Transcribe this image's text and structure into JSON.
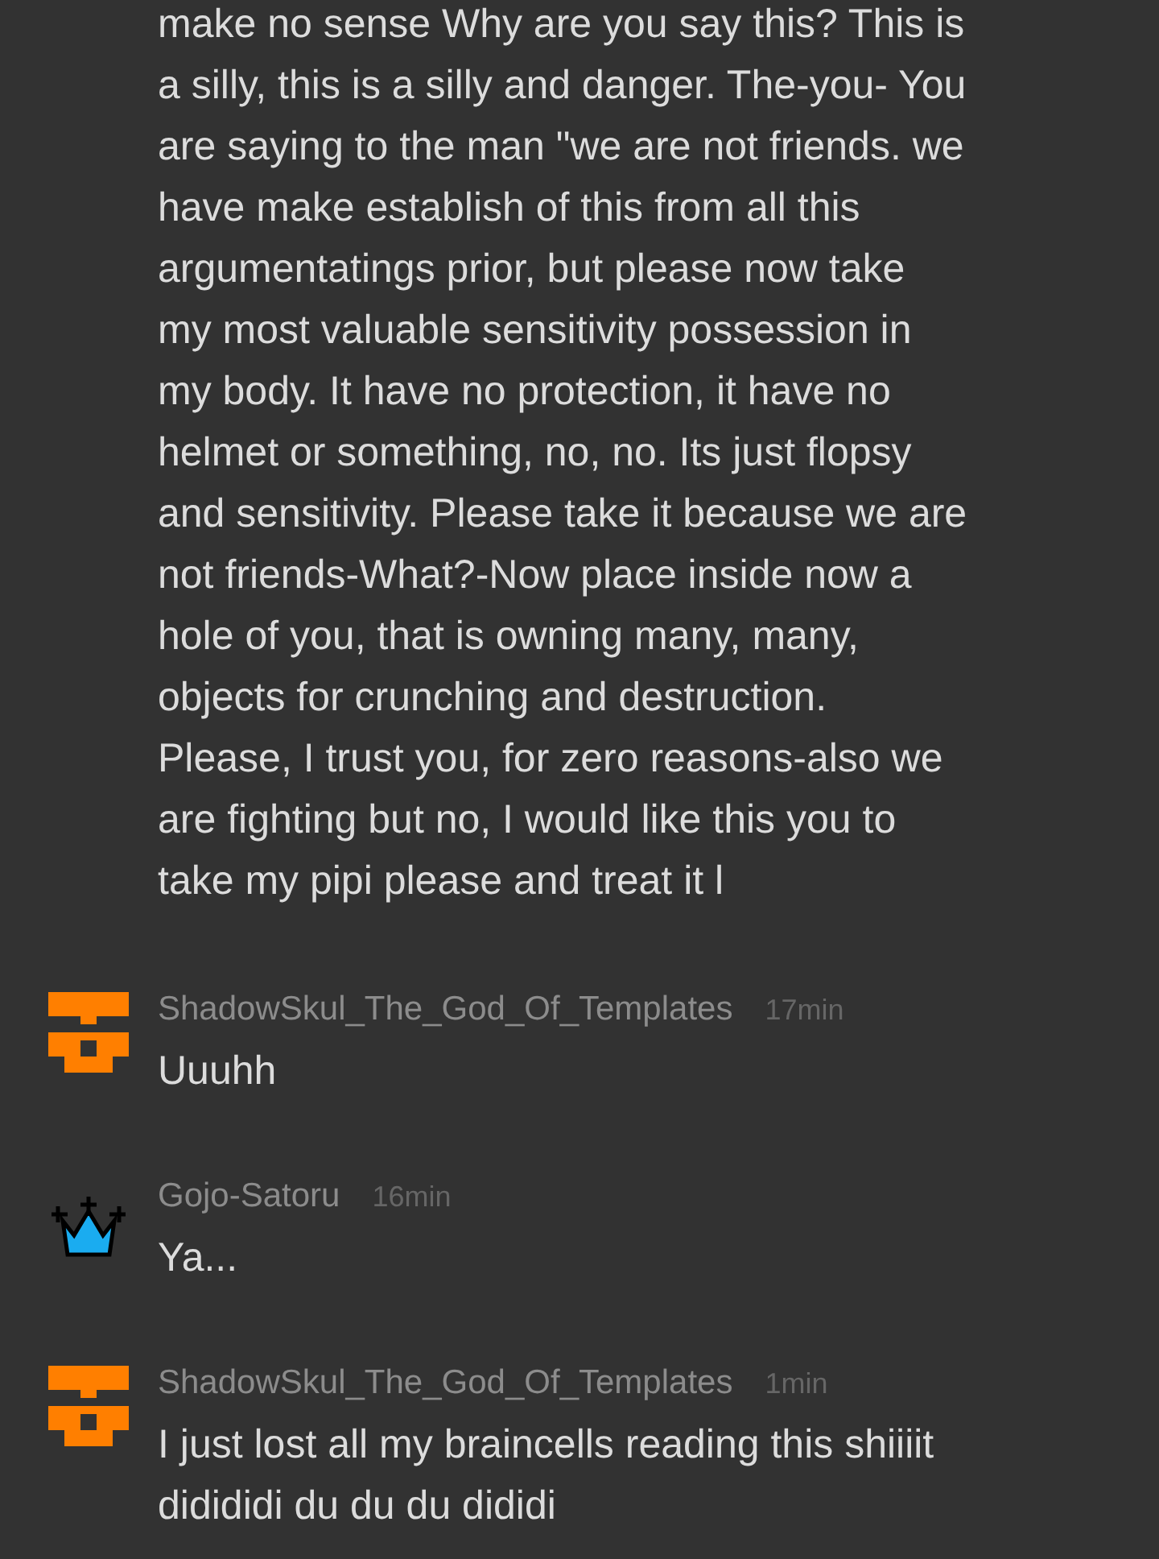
{
  "continued_comment": {
    "text": "make no sense Why are you say this? This is\na silly, this is a silly and danger. The-you- You\nare saying to the man \"we are not friends. we\nhave make establish of this from all this\nargumentatings prior, but please now take\nmy most valuable sensitivity possession in\nmy body. It have no protection, it have no\nhelmet or something, no, no. Its just flopsy\nand sensitivity. Please take it because we are\nnot friends-What?-Now place inside now a\nhole of you, that is owning many, many,\nobjects for crunching and destruction.\nPlease, I trust you, for zero reasons-also we\nare fighting but no, I would like this you to\ntake my pipi please and treat it l"
  },
  "comments": [
    {
      "kind": "skull",
      "author": "ShadowSkul_The_God_Of_Templates",
      "time": "17min",
      "text": "Uuuhh"
    },
    {
      "kind": "crown",
      "author": "Gojo-Satoru",
      "time": "16min",
      "text": "Ya..."
    },
    {
      "kind": "skull",
      "author": "ShadowSkul_The_God_Of_Templates",
      "time": "1min",
      "text": "I just lost all my braincells reading this shiiiit\ndidididi du du du dididi"
    }
  ]
}
